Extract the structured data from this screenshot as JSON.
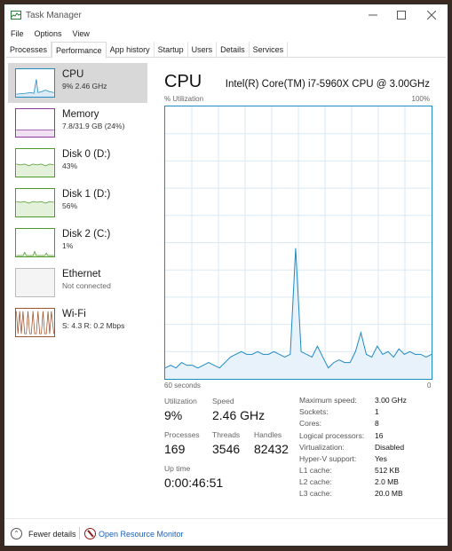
{
  "window": {
    "title": "Task Manager"
  },
  "menu": [
    "File",
    "Options",
    "View"
  ],
  "tabs": [
    "Processes",
    "Performance",
    "App history",
    "Startup",
    "Users",
    "Details",
    "Services"
  ],
  "sidebar": [
    {
      "title": "CPU",
      "subtitle": "9%  2.46 GHz",
      "color": "#1f8ac4"
    },
    {
      "title": "Memory",
      "subtitle": "7.8/31.9 GB (24%)",
      "color": "#8b3a9c"
    },
    {
      "title": "Disk 0 (D:)",
      "subtitle": "43%",
      "color": "#4d9a2a"
    },
    {
      "title": "Disk 1 (D:)",
      "subtitle": "56%",
      "color": "#4d9a2a"
    },
    {
      "title": "Disk 2 (C:)",
      "subtitle": "1%",
      "color": "#4d9a2a"
    },
    {
      "title": "Ethernet",
      "subtitle": "Not connected",
      "color": "#999999"
    },
    {
      "title": "Wi-Fi",
      "subtitle": "S: 4.3  R: 0.2 Mbps",
      "color": "#a0522d"
    }
  ],
  "main": {
    "title": "CPU",
    "cpu_name": "Intel(R) Core(TM) i7-5960X CPU @ 3.00GHz",
    "util_label": "% Utilization",
    "util_max": "100%",
    "time_left": "60 seconds",
    "time_right": "0",
    "utilization_label": "Utilization",
    "utilization_value": "9%",
    "speed_label": "Speed",
    "speed_value": "2.46 GHz",
    "processes_label": "Processes",
    "processes_value": "169",
    "threads_label": "Threads",
    "threads_value": "3546",
    "handles_label": "Handles",
    "handles_value": "82432",
    "uptime_label": "Up time",
    "uptime_value": "0:00:46:51"
  },
  "specs": [
    {
      "label": "Maximum speed:",
      "value": "3.00 GHz"
    },
    {
      "label": "Sockets:",
      "value": "1"
    },
    {
      "label": "Cores:",
      "value": "8"
    },
    {
      "label": "Logical processors:",
      "value": "16"
    },
    {
      "label": "Virtualization:",
      "value": "Disabled"
    },
    {
      "label": "Hyper-V support:",
      "value": "Yes"
    },
    {
      "label": "L1 cache:",
      "value": "512 KB"
    },
    {
      "label": "L2 cache:",
      "value": "2.0 MB"
    },
    {
      "label": "L3 cache:",
      "value": "20.0 MB"
    }
  ],
  "footer": {
    "fewer_details": "Fewer details",
    "open_resource_monitor": "Open Resource Monitor"
  },
  "cpu_history": [
    4,
    5,
    4,
    6,
    5,
    5,
    4,
    5,
    6,
    5,
    4,
    6,
    8,
    9,
    10,
    9,
    9,
    10,
    9,
    9,
    10,
    9,
    8,
    9,
    48,
    10,
    9,
    8,
    12,
    8,
    4,
    6,
    7,
    6,
    6,
    10,
    17,
    9,
    8,
    12,
    9,
    10,
    8,
    11,
    9,
    10,
    9,
    9,
    8,
    9
  ]
}
